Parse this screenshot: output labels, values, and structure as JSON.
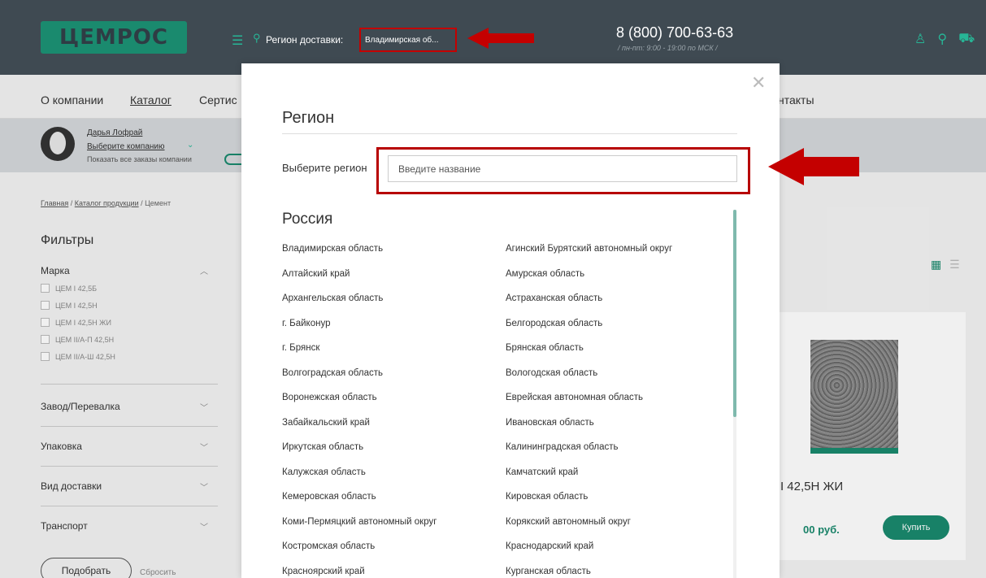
{
  "header": {
    "logo": "ЦЕМРОС",
    "region_label": "Регион доставки:",
    "region_value": "Владимирская об...",
    "phone": "8 (800) 700-63-63",
    "hours": "/ пн-пт: 9:00 - 19:00 по МСК /"
  },
  "nav": {
    "about": "О компании",
    "catalog": "Каталог",
    "cert": "Сертис",
    "contacts": "нтакты"
  },
  "user": {
    "name": "Дарья Лофрай",
    "company": "Выберите компанию",
    "show_all": "Показать все заказы компании"
  },
  "breadcrumb": {
    "home": "Главная",
    "catalog": "Каталог продукции",
    "current": "Цемент"
  },
  "filters": {
    "title": "Фильтры",
    "brand": "Марка",
    "options": [
      "ЦЕМ I 42,5Б",
      "ЦЕМ I 42,5Н",
      "ЦЕМ I 42,5Н ЖИ",
      "ЦЕМ II/А-П 42,5Н",
      "ЦЕМ II/А-Ш 42,5Н"
    ],
    "plant": "Завод/Перевалка",
    "packing": "Упаковка",
    "delivery": "Вид доставки",
    "transport": "Транспорт",
    "pick": "Подобрать",
    "reset": "Сбросить"
  },
  "card": {
    "title": "И I 42,5Н ЖИ",
    "price": "00 руб.",
    "buy": "Купить"
  },
  "modal": {
    "title": "Регион",
    "select_label": "Выберите регион",
    "placeholder": "Введите название",
    "country": "Россия",
    "regions": [
      "Владимирская область",
      "Агинский Бурятский автономный округ",
      "Алтайский край",
      "Амурская область",
      "Архангельская область",
      "Астраханская область",
      "г. Байконур",
      "Белгородская область",
      "г. Брянск",
      "Брянская область",
      "Волгоградская область",
      "Вологодская область",
      "Воронежская область",
      "Еврейская автономная область",
      "Забайкальский край",
      "Ивановская область",
      "Иркутская область",
      "Калининградская область",
      "Калужская область",
      "Камчатский край",
      "Кемеровская область",
      "Кировская область",
      "Коми-Пермяцкий автономный округ",
      "Корякский автономный округ",
      "Костромская область",
      "Краснодарский край",
      "Красноярский край",
      "Курганская область"
    ]
  },
  "colors": {
    "header_bg": "#3f4a52",
    "accent": "#1a8a6e",
    "highlight_red": "#c40000"
  }
}
